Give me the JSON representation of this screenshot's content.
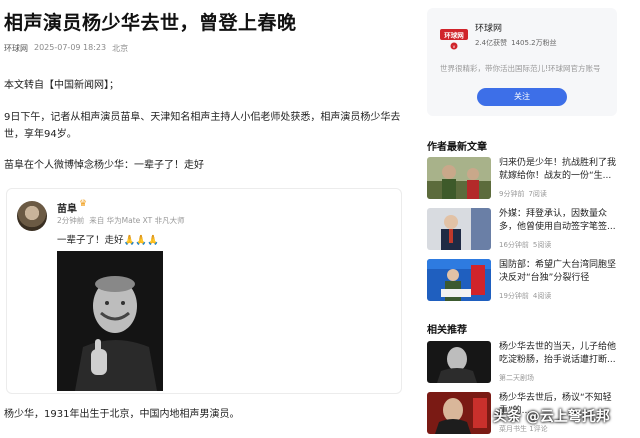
{
  "article": {
    "title": "相声演员杨少华去世，曾登上春晚",
    "source": "环球网",
    "datetime": "2025-07-09 18:23",
    "location": "北京",
    "p1": "本文转自【中国新闻网】；",
    "p2": "9日下午，记者从相声演员苗阜、天津知名相声主持人小佀老师处获悉，相声演员杨少华去世，享年94岁。",
    "p3": "苗阜在个人微博悼念杨少华：一辈子了！走好",
    "p4": "杨少华，1931年出生于北京，中国内地相声男演员。"
  },
  "weibo": {
    "name": "苗阜",
    "badge": "♛",
    "time": "2分钟前",
    "from": "来自 华为Mate XT 非凡大师",
    "text": "一辈子了！走好🙏🙏🙏"
  },
  "profile": {
    "logo_text": "环球网",
    "name": "环球网",
    "followers_get": "2.4亿获赞",
    "fans": "1405.2万粉丝",
    "desc": "世界很精彩，带你活出国际范儿!环球网官方账号",
    "follow": "关注"
  },
  "author_section": {
    "title": "作者最新文章",
    "items": [
      {
        "title": "归来仍是少年！抗战胜利了我就嫁给你！战友的一份“生...",
        "time": "9分钟前",
        "reads": "7阅读"
      },
      {
        "title": "外媒：拜登承认，因数量众多，他曾使用自动签字笔签...",
        "time": "16分钟前",
        "reads": "5阅读"
      },
      {
        "title": "国防部：希望广大台湾同胞坚决反对“台独”分裂行径",
        "time": "19分钟前",
        "reads": "4阅读"
      }
    ]
  },
  "related_section": {
    "title": "相关推荐",
    "items": [
      {
        "title": "杨少华去世的当天，儿子给他吃淀粉肠，抬手说话遭打断...",
        "meta": "第二天剧场"
      },
      {
        "title": "杨少华去世后，杨议“不知轻重”的...",
        "meta": "菜月书生 1评论"
      }
    ]
  },
  "watermark": "头条 @云上弩托邦"
}
